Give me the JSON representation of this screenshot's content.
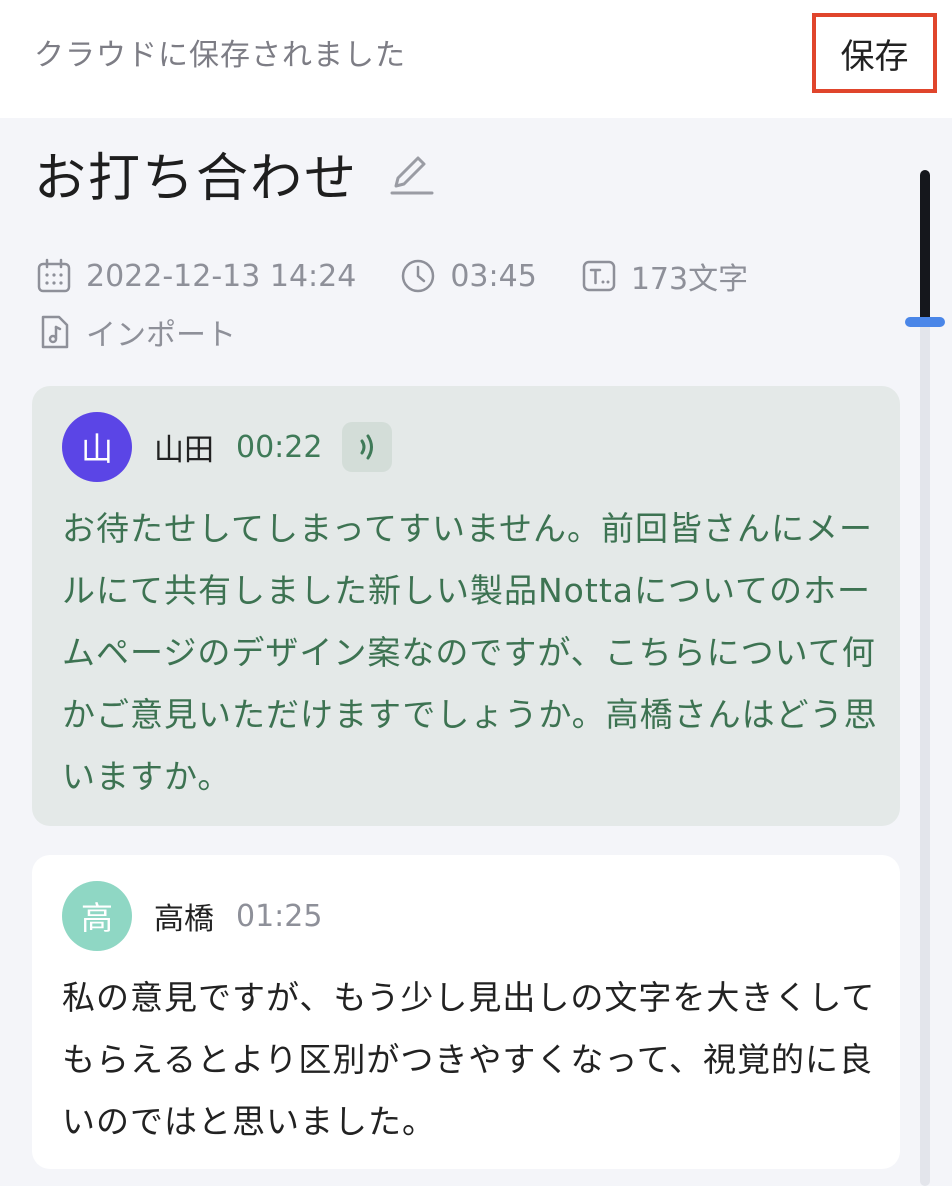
{
  "header": {
    "status_text": "クラウドに保存されました",
    "save_label": "保存"
  },
  "note": {
    "title": "お打ち合わせ",
    "date": "2022-12-13 14:24",
    "duration": "03:45",
    "char_count": "173文字",
    "source": "インポート"
  },
  "transcript": [
    {
      "avatar": "山",
      "avatar_color": "#5b45e6",
      "speaker": "山田",
      "time": "00:22",
      "playing": true,
      "text": "お待たせしてしまってすいません。前回皆さんにメールにて共有しました新しい製品Nottaについてのホームページのデザイン案なのですが、こちらについて何かご意見いただけますでしょうか。高橋さんはどう思いますか。"
    },
    {
      "avatar": "高",
      "avatar_color": "#8fd7c4",
      "speaker": "高橋",
      "time": "01:25",
      "playing": false,
      "text": "私の意見ですが、もう少し見出しの文字を大きくしてもらえるとより区別がつきやすくなって、視覚的に良いのではと思いました。"
    }
  ],
  "colors": {
    "accent_red": "#e0452c",
    "active_text": "#3d7352",
    "scroll_handle": "#4a86e8"
  }
}
